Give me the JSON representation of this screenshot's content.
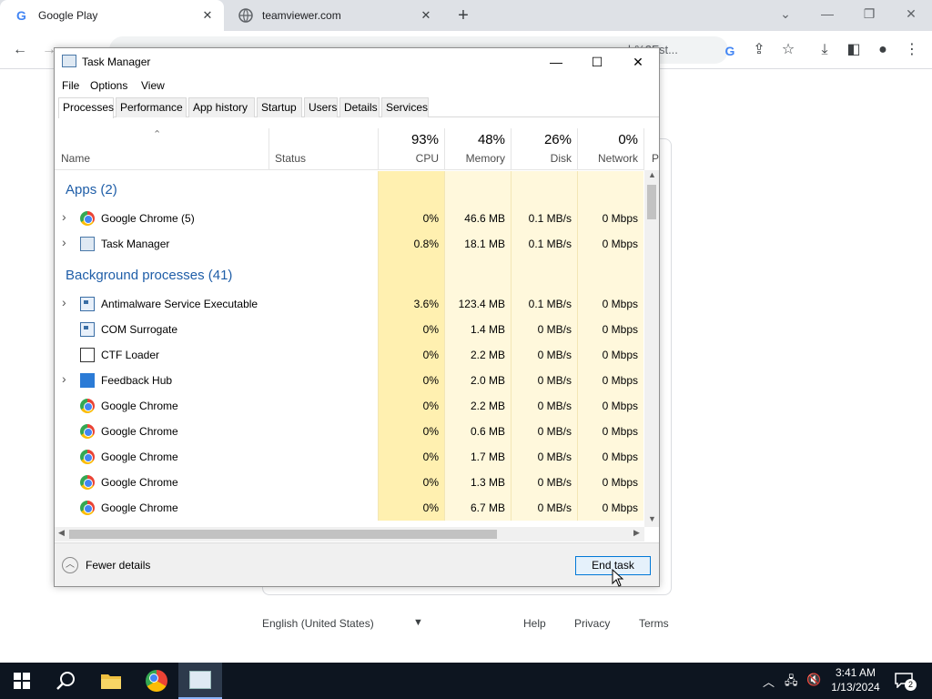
{
  "browser": {
    "tabs": [
      {
        "title": "Google Play",
        "active": true
      },
      {
        "title": "teamviewer.com",
        "active": false
      }
    ],
    "url_fragment": "b%2Fst..."
  },
  "page_footer": {
    "language": "English (United States)",
    "links": [
      "Help",
      "Privacy",
      "Terms"
    ]
  },
  "task_manager": {
    "title": "Task Manager",
    "menu": [
      "File",
      "Options",
      "View"
    ],
    "tabs": [
      "Processes",
      "Performance",
      "App history",
      "Startup",
      "Users",
      "Details",
      "Services"
    ],
    "active_tab": "Processes",
    "columns": {
      "name": "Name",
      "status": "Status",
      "cpu": {
        "pct": "93%",
        "label": "CPU"
      },
      "memory": {
        "pct": "48%",
        "label": "Memory"
      },
      "disk": {
        "pct": "26%",
        "label": "Disk"
      },
      "network": {
        "pct": "0%",
        "label": "Network"
      },
      "power_partial": "P"
    },
    "groups": {
      "apps": "Apps (2)",
      "background": "Background processes (41)"
    },
    "app_rows": [
      {
        "name": "Google Chrome (5)",
        "icon": "chrome-icon",
        "expand": true,
        "cpu": "0%",
        "memory": "46.6 MB",
        "disk": "0.1 MB/s",
        "network": "0 Mbps"
      },
      {
        "name": "Task Manager",
        "icon": "task-manager-icon",
        "expand": true,
        "cpu": "0.8%",
        "memory": "18.1 MB",
        "disk": "0.1 MB/s",
        "network": "0 Mbps"
      }
    ],
    "bg_rows": [
      {
        "name": "Antimalware Service Executable",
        "icon": "service-icon",
        "expand": true,
        "cpu": "3.6%",
        "memory": "123.4 MB",
        "disk": "0.1 MB/s",
        "network": "0 Mbps"
      },
      {
        "name": "COM Surrogate",
        "icon": "service-icon",
        "expand": false,
        "cpu": "0%",
        "memory": "1.4 MB",
        "disk": "0 MB/s",
        "network": "0 Mbps"
      },
      {
        "name": "CTF Loader",
        "icon": "ctf-icon",
        "expand": false,
        "cpu": "0%",
        "memory": "2.2 MB",
        "disk": "0 MB/s",
        "network": "0 Mbps"
      },
      {
        "name": "Feedback Hub",
        "icon": "feedback-hub-icon",
        "expand": true,
        "cpu": "0%",
        "memory": "2.0 MB",
        "disk": "0 MB/s",
        "network": "0 Mbps"
      },
      {
        "name": "Google Chrome",
        "icon": "chrome-icon",
        "expand": false,
        "cpu": "0%",
        "memory": "2.2 MB",
        "disk": "0 MB/s",
        "network": "0 Mbps"
      },
      {
        "name": "Google Chrome",
        "icon": "chrome-icon",
        "expand": false,
        "cpu": "0%",
        "memory": "0.6 MB",
        "disk": "0 MB/s",
        "network": "0 Mbps"
      },
      {
        "name": "Google Chrome",
        "icon": "chrome-icon",
        "expand": false,
        "cpu": "0%",
        "memory": "1.7 MB",
        "disk": "0 MB/s",
        "network": "0 Mbps"
      },
      {
        "name": "Google Chrome",
        "icon": "chrome-icon",
        "expand": false,
        "cpu": "0%",
        "memory": "1.3 MB",
        "disk": "0 MB/s",
        "network": "0 Mbps"
      },
      {
        "name": "Google Chrome",
        "icon": "chrome-icon",
        "expand": false,
        "cpu": "0%",
        "memory": "6.7 MB",
        "disk": "0 MB/s",
        "network": "0 Mbps"
      }
    ],
    "fewer_details": "Fewer details",
    "end_task": "End task"
  },
  "taskbar": {
    "time": "3:41 AM",
    "date": "1/13/2024",
    "notification_count": "2"
  },
  "colors": {
    "cpu_hot": "#fff0b0",
    "col_light": "#fff8dc",
    "group_blue": "#1f5ea8",
    "accent": "#0078d7"
  }
}
